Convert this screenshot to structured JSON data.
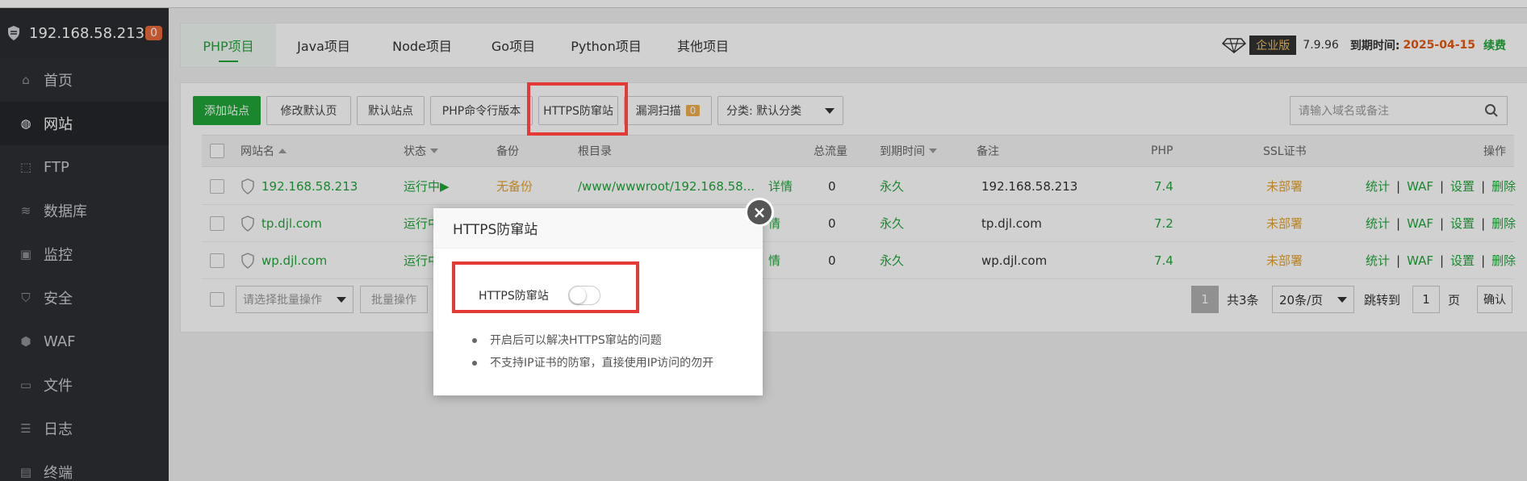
{
  "sidebar": {
    "host": "192.168.58.213",
    "badge": "0",
    "items": [
      {
        "label": "首页"
      },
      {
        "label": "网站"
      },
      {
        "label": "FTP"
      },
      {
        "label": "数据库"
      },
      {
        "label": "监控"
      },
      {
        "label": "安全"
      },
      {
        "label": "WAF"
      },
      {
        "label": "文件"
      },
      {
        "label": "日志"
      },
      {
        "label": "终端"
      }
    ]
  },
  "tabs": [
    "PHP项目",
    "Java项目",
    "Node项目",
    "Go项目",
    "Python项目",
    "其他项目"
  ],
  "version": {
    "edition": "企业版",
    "number": "7.9.96",
    "expire_label": "到期时间:",
    "expire_date": "2025-04-15",
    "renew": "续费"
  },
  "toolbar": {
    "add_site": "添加站点",
    "modify_default": "修改默认页",
    "default_site": "默认站点",
    "php_cli": "PHP命令行版本",
    "https_guard": "HTTPS防窜站",
    "vuln_scan": "漏洞扫描",
    "vuln_count": "0",
    "category": "分类: 默认分类",
    "search_placeholder": "请输入域名或备注"
  },
  "table": {
    "headers": {
      "name": "网站名",
      "status": "状态",
      "backup": "备份",
      "root": "根目录",
      "traffic": "总流量",
      "expire": "到期时间",
      "remark": "备注",
      "php": "PHP",
      "ssl": "SSL证书",
      "ops": "操作"
    },
    "rows": [
      {
        "name": "192.168.58.213",
        "status": "运行中▶",
        "backup": "无备份",
        "root": "/www/wwwroot/192.168.58...",
        "detail": "详情",
        "traffic": "0",
        "expire": "永久",
        "remark": "192.168.58.213",
        "php": "7.4",
        "ssl": "未部署"
      },
      {
        "name": "tp.djl.com",
        "status": "运行中",
        "backup": "",
        "root": "",
        "detail": "情",
        "traffic": "0",
        "expire": "永久",
        "remark": "tp.djl.com",
        "php": "7.2",
        "ssl": "未部署"
      },
      {
        "name": "wp.djl.com",
        "status": "运行中",
        "backup": "",
        "root": "",
        "detail": "情",
        "traffic": "0",
        "expire": "永久",
        "remark": "wp.djl.com",
        "php": "7.4",
        "ssl": "未部署"
      }
    ],
    "ops": [
      "统计",
      "WAF",
      "设置",
      "删除"
    ]
  },
  "footer": {
    "batch_placeholder": "请选择批量操作",
    "batch_button": "批量操作",
    "page": "1",
    "total": "共3条",
    "per_page": "20条/页",
    "jump_label": "跳转到",
    "jump_value": "1",
    "page_unit": "页",
    "confirm": "确认"
  },
  "modal": {
    "title": "HTTPS防窜站",
    "toggle_label": "HTTPS防窜站",
    "toggle_on": false,
    "notes": [
      "开启后可以解决HTTPS窜站的问题",
      "不支持IP证书的防窜，直接使用IP访问的勿开"
    ]
  },
  "colors": {
    "accent": "#20a53a",
    "highlight": "#e53935",
    "warning": "#e5a12b",
    "sidebar_bg": "#2c2f34"
  }
}
